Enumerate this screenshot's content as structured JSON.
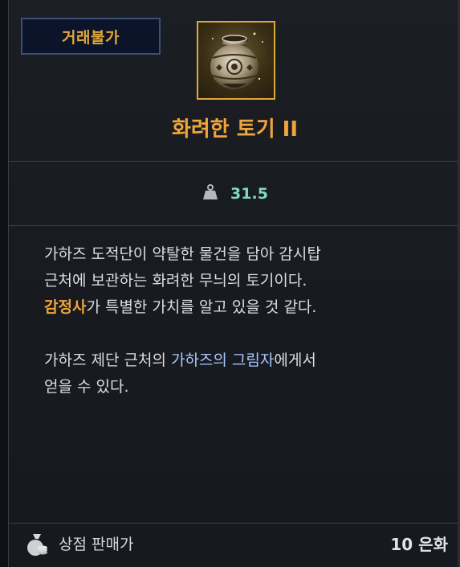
{
  "tooltip": {
    "trade_status": "거래불가",
    "item_name": "화려한 토기 II",
    "weight_value": "31.5",
    "icons": {
      "item": "pottery-jar-icon",
      "weight": "weight-icon",
      "money": "moneybag-icon"
    },
    "description": {
      "p1_part1": "가하즈 도적단이 약탈한 물건을 담아 감시탑",
      "p1_part2": "근처에 보관하는 화려한 무늬의 토기이다.",
      "p1_highlight": "감정사",
      "p1_part3": "가 특별한 가치를 알고 있을 것 같다.",
      "p2_part1": "가하즈 제단 근처의 ",
      "p2_highlight": "가하즈의 그림자",
      "p2_part2": "에게서",
      "p2_part3": "얻을 수 있다."
    },
    "footer": {
      "label": "상점 판매가",
      "price": "10 은화"
    },
    "colors": {
      "item_name": "#f0a53a",
      "weight_value": "#7fd8c6",
      "npc_highlight": "#f0a53a",
      "location_highlight": "#a9c7ff"
    }
  }
}
